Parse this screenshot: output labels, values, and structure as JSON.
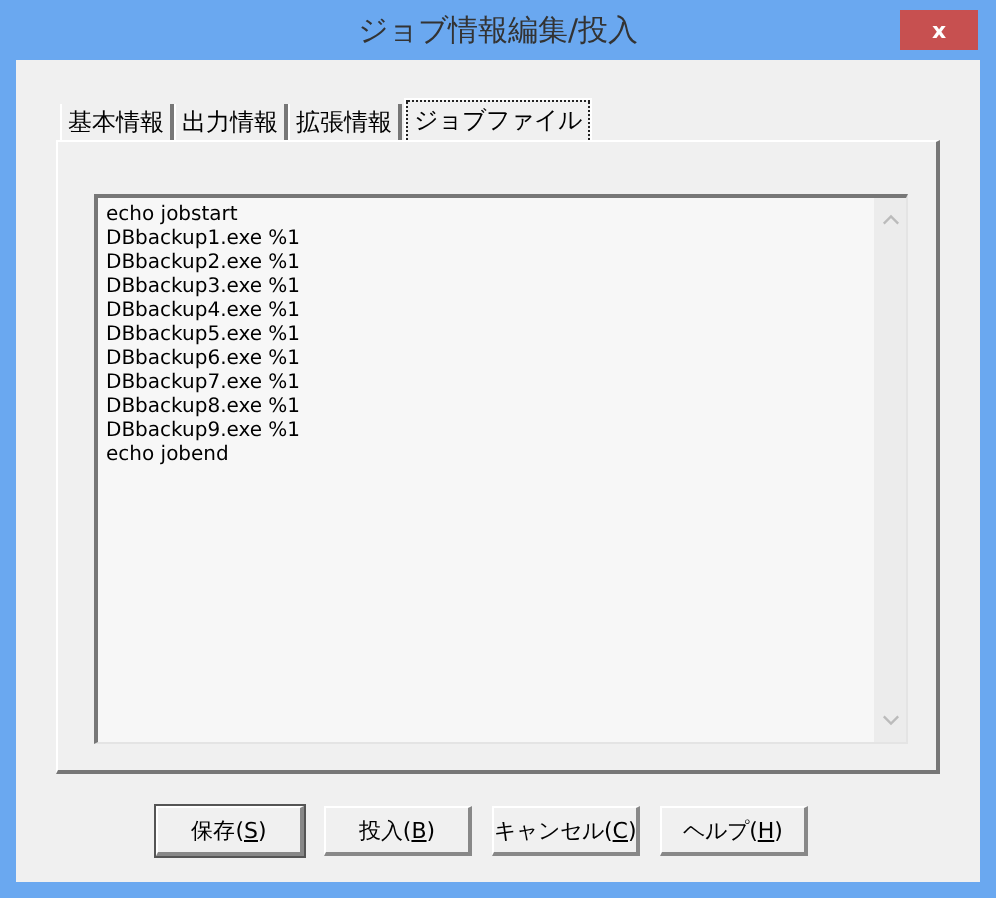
{
  "window": {
    "title": "ジョブ情報編集/投入",
    "close": "x"
  },
  "tabs": [
    {
      "label": "基本情報",
      "selected": false
    },
    {
      "label": "出力情報",
      "selected": false
    },
    {
      "label": "拡張情報",
      "selected": false
    },
    {
      "label": "ジョブファイル",
      "selected": true
    }
  ],
  "job_file": {
    "lines": [
      "echo jobstart",
      "DBbackup1.exe %1",
      "DBbackup2.exe %1",
      "DBbackup3.exe %1",
      "DBbackup4.exe %1",
      "DBbackup5.exe %1",
      "DBbackup6.exe %1",
      "DBbackup7.exe %1",
      "DBbackup8.exe %1",
      "DBbackup9.exe %1",
      "echo jobend"
    ]
  },
  "buttons": [
    {
      "prefix": "保存(",
      "access_key": "S",
      "suffix": ")",
      "default": true
    },
    {
      "prefix": "投入(",
      "access_key": "B",
      "suffix": ")",
      "default": false
    },
    {
      "prefix": "キャンセル(",
      "access_key": "C",
      "suffix": ")",
      "default": false
    },
    {
      "prefix": "ヘルプ(",
      "access_key": "H",
      "suffix": ")",
      "default": false
    }
  ]
}
